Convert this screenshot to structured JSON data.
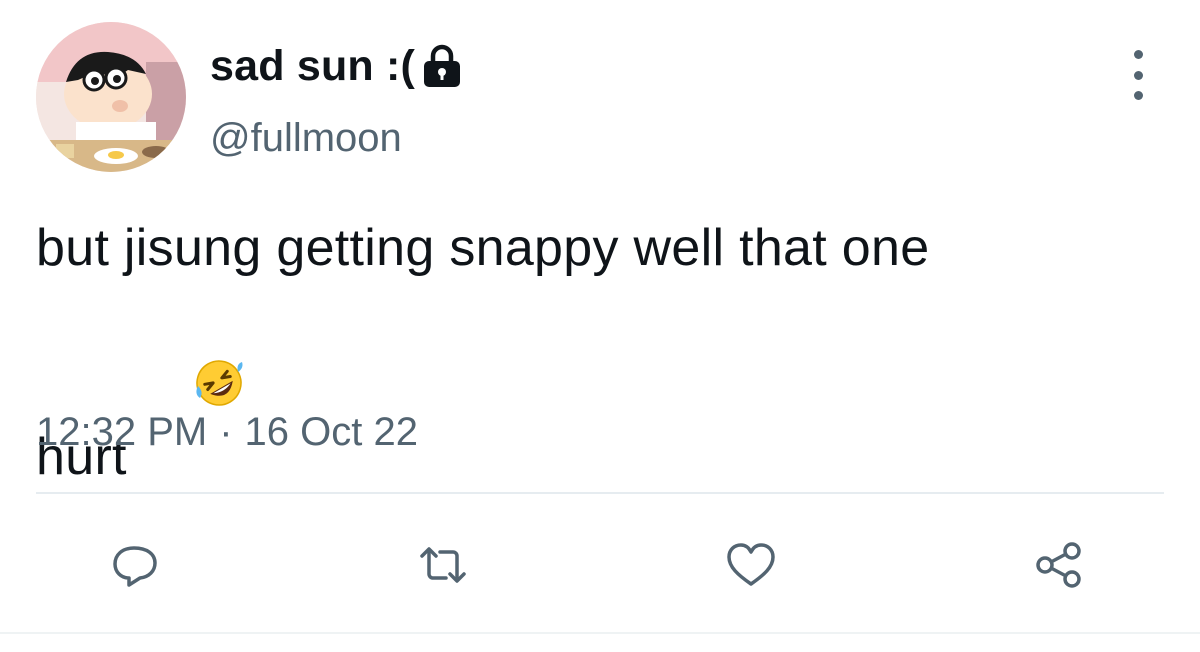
{
  "user": {
    "display_name": "sad sun :(",
    "handle": "@fullmoon",
    "avatar_icon": "cartoon-avatar",
    "protected_icon": "lock-icon"
  },
  "tweet": {
    "text_line1": "but jisung getting snappy well that one",
    "text_line2": "hurt",
    "emoji_icon": "rolling-on-floor-laughing-emoji"
  },
  "meta": {
    "time": "12:32 PM",
    "separator": "·",
    "date": "16 Oct 22"
  },
  "actions": [
    {
      "name": "reply",
      "icon": "reply-icon"
    },
    {
      "name": "retweet",
      "icon": "retweet-icon"
    },
    {
      "name": "like",
      "icon": "heart-icon"
    },
    {
      "name": "share",
      "icon": "share-icon"
    }
  ],
  "colors": {
    "text": "#0f1419",
    "secondary": "#536471",
    "divider": "#e6ecf0",
    "icon": "#536471"
  }
}
